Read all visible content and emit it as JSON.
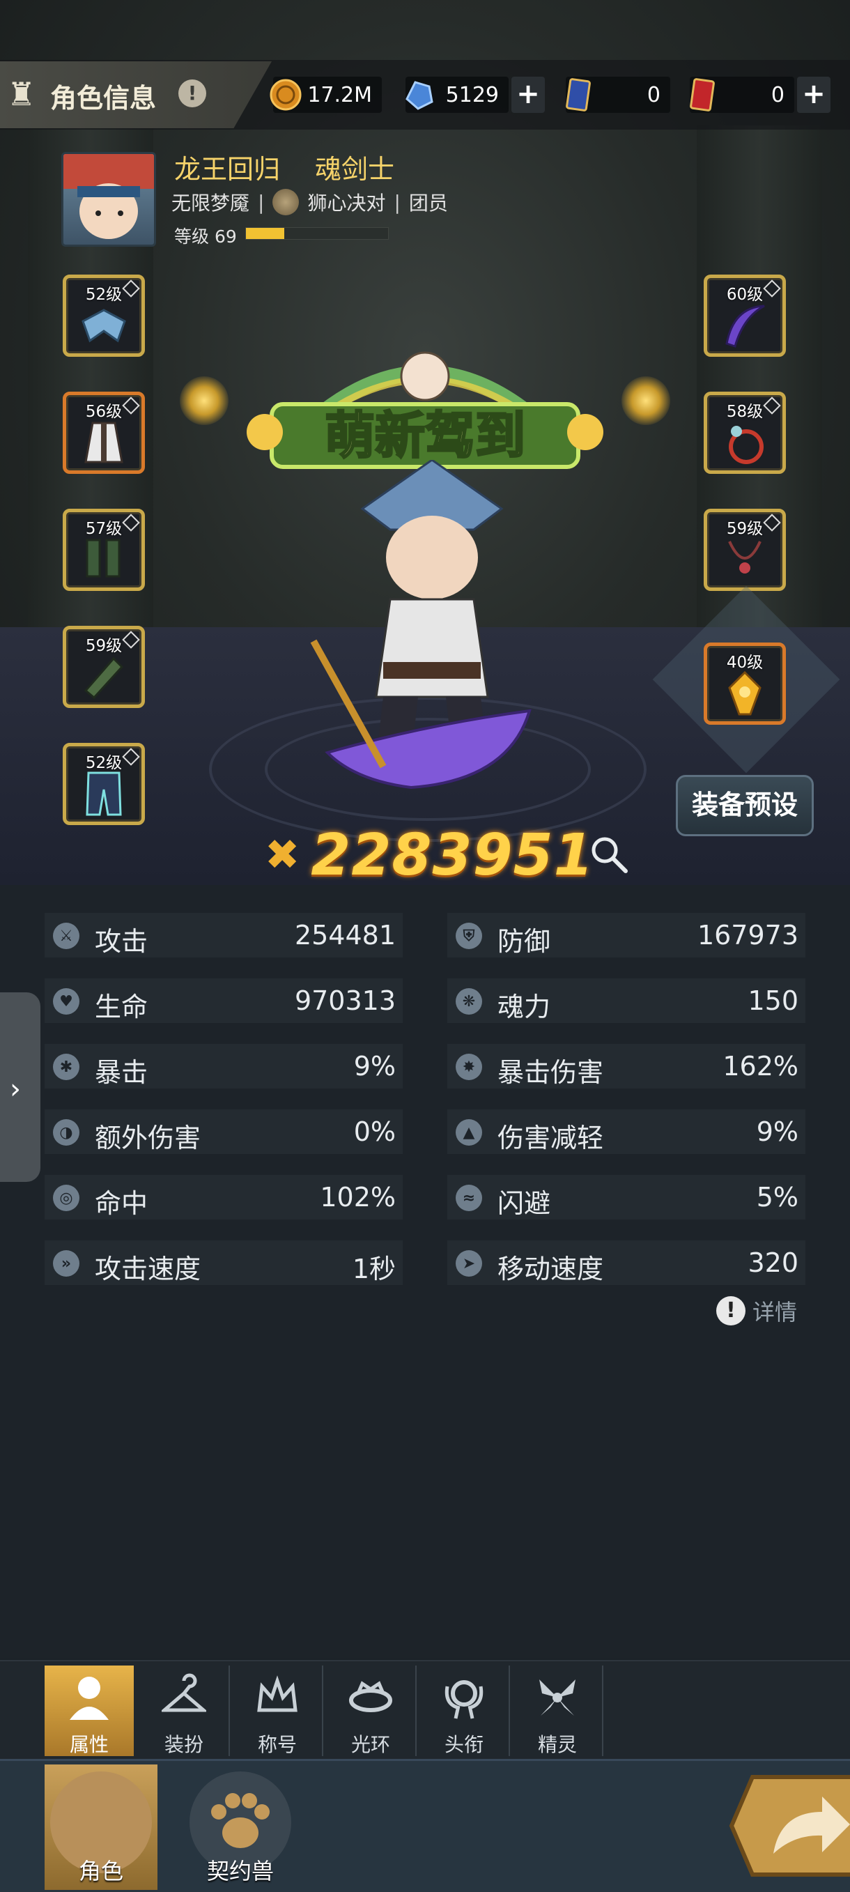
{
  "header": {
    "title": "角色信息",
    "resources": [
      {
        "name": "gold",
        "value": "17.2M"
      },
      {
        "name": "crystal",
        "value": "5129"
      },
      {
        "name": "blue-card",
        "value": "0"
      },
      {
        "name": "gold-card",
        "value": "0"
      }
    ]
  },
  "profile": {
    "name": "龙王回归",
    "class": "魂剑士",
    "realm": "无限梦魇",
    "guild": "狮心决对",
    "role": "团员",
    "level_label": "等级 69",
    "level_progress": 0.27
  },
  "equipment": {
    "left": [
      {
        "level": "52级",
        "frame": "gold"
      },
      {
        "level": "56级",
        "frame": "orange"
      },
      {
        "level": "57级",
        "frame": "gold"
      },
      {
        "level": "59级",
        "frame": "gold"
      },
      {
        "level": "52级",
        "frame": "gold"
      }
    ],
    "right": [
      {
        "level": "60级",
        "frame": "gold"
      },
      {
        "level": "58级",
        "frame": "gold"
      },
      {
        "level": "59级",
        "frame": "gold"
      },
      {
        "level": "40级",
        "frame": "orange"
      }
    ]
  },
  "title_banner": "萌新驾到",
  "preset_button": "装备预设",
  "combat_power": "2283951",
  "stats": {
    "left": [
      {
        "label": "攻击",
        "value": "254481"
      },
      {
        "label": "生命",
        "value": "970313"
      },
      {
        "label": "暴击",
        "value": "9%"
      },
      {
        "label": "额外伤害",
        "value": "0%"
      },
      {
        "label": "命中",
        "value": "102%"
      },
      {
        "label": "攻击速度",
        "value": "1秒"
      }
    ],
    "right": [
      {
        "label": "防御",
        "value": "167973"
      },
      {
        "label": "魂力",
        "value": "150"
      },
      {
        "label": "暴击伤害",
        "value": "162%"
      },
      {
        "label": "伤害减轻",
        "value": "9%"
      },
      {
        "label": "闪避",
        "value": "5%"
      },
      {
        "label": "移动速度",
        "value": "320"
      }
    ]
  },
  "details_label": "详情",
  "tabs": [
    "属性",
    "装扮",
    "称号",
    "光环",
    "头衔",
    "精灵"
  ],
  "nav": [
    "角色",
    "契约兽"
  ]
}
